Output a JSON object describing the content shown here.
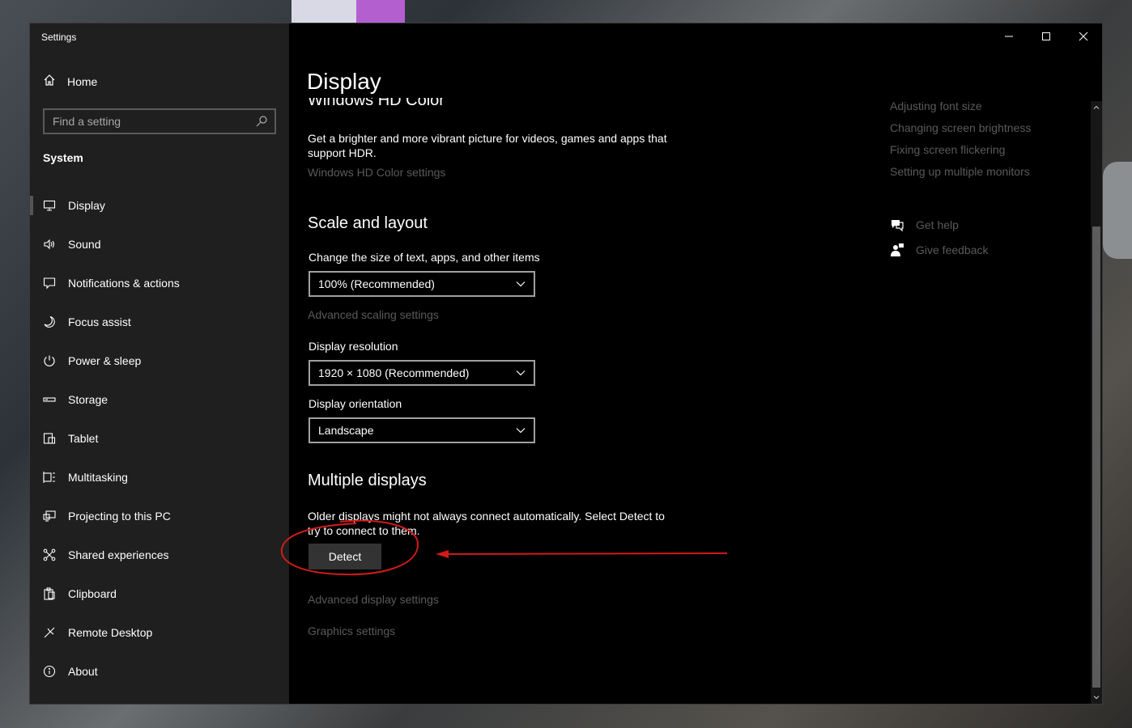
{
  "window": {
    "title": "Settings"
  },
  "sidebar": {
    "home_label": "Home",
    "search_placeholder": "Find a setting",
    "section_title": "System",
    "items": [
      {
        "label": "Display",
        "icon": "monitor-icon"
      },
      {
        "label": "Sound",
        "icon": "speaker-icon"
      },
      {
        "label": "Notifications & actions",
        "icon": "notification-icon"
      },
      {
        "label": "Focus assist",
        "icon": "moon-icon"
      },
      {
        "label": "Power & sleep",
        "icon": "power-icon"
      },
      {
        "label": "Storage",
        "icon": "storage-icon"
      },
      {
        "label": "Tablet",
        "icon": "tablet-icon"
      },
      {
        "label": "Multitasking",
        "icon": "multitasking-icon"
      },
      {
        "label": "Projecting to this PC",
        "icon": "projecting-icon"
      },
      {
        "label": "Shared experiences",
        "icon": "shared-icon"
      },
      {
        "label": "Clipboard",
        "icon": "clipboard-icon"
      },
      {
        "label": "Remote Desktop",
        "icon": "remote-desktop-icon"
      },
      {
        "label": "About",
        "icon": "info-icon"
      }
    ]
  },
  "main": {
    "page_title": "Display",
    "hd_color": {
      "heading": "Windows HD Color",
      "description": "Get a brighter and more vibrant picture for videos, games and apps that support HDR.",
      "link": "Windows HD Color settings"
    },
    "scale_layout": {
      "heading": "Scale and layout",
      "size_label": "Change the size of text, apps, and other items",
      "size_value": "100% (Recommended)",
      "advanced_scaling_link": "Advanced scaling settings",
      "resolution_label": "Display resolution",
      "resolution_value": "1920 × 1080 (Recommended)",
      "orientation_label": "Display orientation",
      "orientation_value": "Landscape"
    },
    "multiple_displays": {
      "heading": "Multiple displays",
      "description": "Older displays might not always connect automatically. Select Detect to try to connect to them.",
      "detect_button": "Detect",
      "advanced_display_link": "Advanced display settings",
      "graphics_link": "Graphics settings"
    }
  },
  "related": {
    "links": [
      "Adjusting font size",
      "Changing screen brightness",
      "Fixing screen flickering",
      "Setting up multiple monitors"
    ],
    "get_help": "Get help",
    "give_feedback": "Give feedback"
  },
  "colors": {
    "annotation": "#d11a1a",
    "dim_link": "#5a5a5a"
  }
}
